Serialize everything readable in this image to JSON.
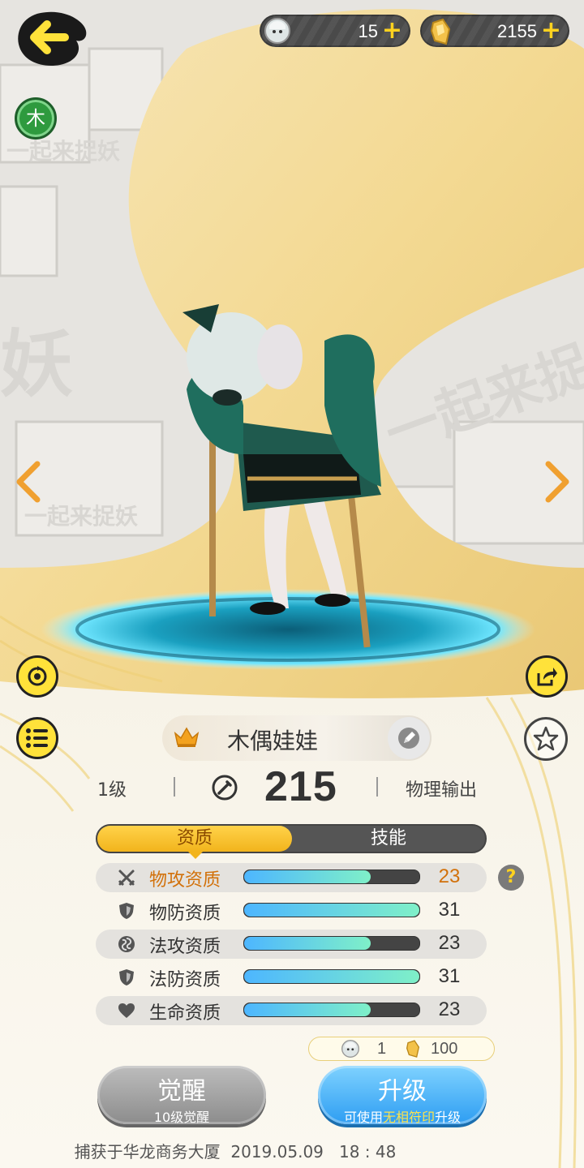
{
  "currencies": [
    {
      "icon": "doll-face-icon",
      "value": "15",
      "plus": "+"
    },
    {
      "icon": "crystal-icon",
      "value": "2155",
      "plus": "+"
    }
  ],
  "element_badge": "木",
  "pet": {
    "name": "木偶娃娃",
    "level": "1级",
    "power": "215",
    "role": "物理输出"
  },
  "tabs": [
    "资质",
    "技能"
  ],
  "attributes": [
    {
      "label": "物攻资质",
      "value": "23",
      "fill": 0.72,
      "icon": "crossed-swords-icon",
      "highlight": true
    },
    {
      "label": "物防资质",
      "value": "31",
      "fill": 1.0,
      "icon": "shield-icon",
      "highlight": false
    },
    {
      "label": "法攻资质",
      "value": "23",
      "fill": 0.72,
      "icon": "swirl-icon",
      "highlight": false
    },
    {
      "label": "法防资质",
      "value": "31",
      "fill": 1.0,
      "icon": "shield-icon",
      "highlight": false
    },
    {
      "label": "生命资质",
      "value": "23",
      "fill": 0.72,
      "icon": "heart-icon",
      "highlight": false
    }
  ],
  "help": "?",
  "cost": {
    "item1": "1",
    "item2": "100"
  },
  "buttons": {
    "awaken_title": "觉醒",
    "awaken_sub": "10级觉醒",
    "upgrade_title": "升级",
    "upgrade_sub_pre": "可使用",
    "upgrade_sub_hl": "无相符印",
    "upgrade_sub_post": "升级"
  },
  "footer": {
    "text": "捕获于华龙商务大厦",
    "date": "2019.05.09",
    "time": "18 : 48"
  },
  "colors": {
    "gold": "#f2b41c",
    "teal": "#1f8fa8",
    "yellow_button": "#ffe23a",
    "accent_orange": "#d2710a"
  }
}
